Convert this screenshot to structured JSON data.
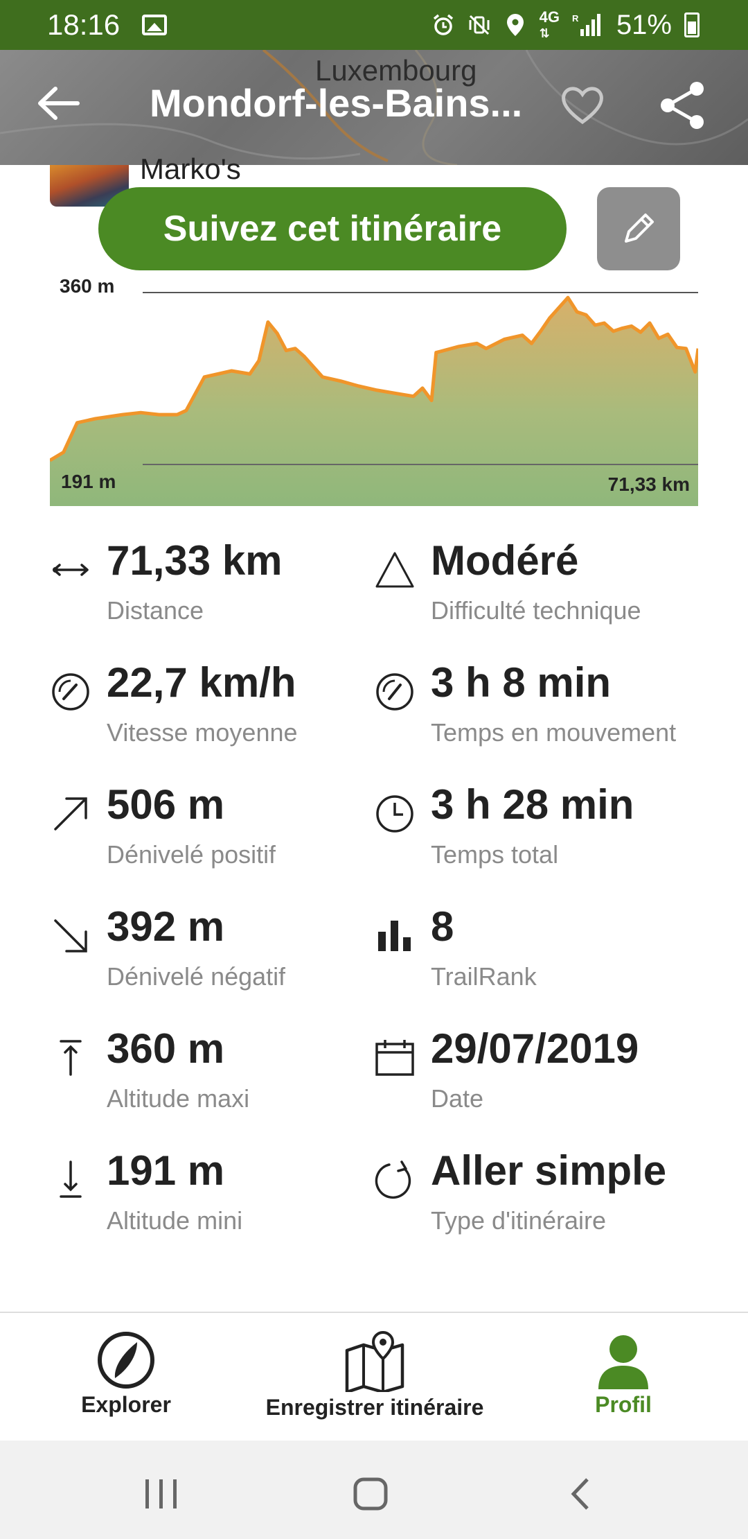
{
  "status_bar": {
    "time": "18:16",
    "network_top": "4G",
    "network_bottom": "R",
    "battery": "51%"
  },
  "header": {
    "map_label": "Luxembourg",
    "title": "Mondorf-les-Bains..."
  },
  "author": {
    "name": "Marko's"
  },
  "actions": {
    "follow_label": "Suivez cet itinéraire"
  },
  "chart_data": {
    "type": "area",
    "title": "",
    "xlabel": "",
    "ylabel": "",
    "y_max_label": "360 m",
    "y_min_label": "191 m",
    "x_end_label": "71,33 km",
    "xlim": [
      0,
      71.33
    ],
    "ylim": [
      191,
      360
    ],
    "x": [
      0,
      1.5,
      3,
      5,
      8,
      10,
      12,
      14,
      15,
      17,
      20,
      22,
      23,
      24,
      25,
      26,
      27,
      28,
      30,
      32,
      34,
      36,
      38,
      40,
      41,
      42,
      42.5,
      45,
      47,
      48,
      50,
      52,
      53,
      54,
      55,
      56,
      57,
      58,
      59,
      60,
      61,
      62,
      63,
      64,
      65,
      66,
      67,
      68,
      69,
      70,
      71,
      71.33
    ],
    "y": [
      195,
      203,
      232,
      236,
      240,
      242,
      240,
      240,
      244,
      277,
      283,
      280,
      293,
      331,
      320,
      303,
      305,
      297,
      277,
      273,
      268,
      264,
      261,
      258,
      266,
      254,
      301,
      307,
      310,
      305,
      314,
      318,
      310,
      322,
      335,
      345,
      355,
      341,
      338,
      328,
      330,
      322,
      325,
      327,
      321,
      330,
      315,
      319,
      306,
      305,
      282,
      305
    ],
    "fill_top_color": "#d8b06a",
    "fill_bottom_color": "#8fb77b",
    "line_color": "#f0952a"
  },
  "stats": [
    {
      "icon": "distance-icon",
      "value": "71,33 km",
      "label": "Distance"
    },
    {
      "icon": "difficulty-icon",
      "value": "Modéré",
      "label": "Difficulté technique"
    },
    {
      "icon": "speed-icon",
      "value": "22,7 km/h",
      "label": "Vitesse moyenne"
    },
    {
      "icon": "moving-time-icon",
      "value": "3 h 8 min",
      "label": "Temps en mouvement"
    },
    {
      "icon": "elevation-gain-icon",
      "value": "506 m",
      "label": "Dénivelé positif"
    },
    {
      "icon": "clock-icon",
      "value": "3 h 28 min",
      "label": "Temps total"
    },
    {
      "icon": "elevation-loss-icon",
      "value": "392 m",
      "label": "Dénivelé négatif"
    },
    {
      "icon": "trailrank-icon",
      "value": "8",
      "label": "TrailRank"
    },
    {
      "icon": "altitude-max-icon",
      "value": "360 m",
      "label": "Altitude maxi"
    },
    {
      "icon": "calendar-icon",
      "value": "29/07/2019",
      "label": "Date"
    },
    {
      "icon": "altitude-min-icon",
      "value": "191 m",
      "label": "Altitude mini"
    },
    {
      "icon": "route-type-icon",
      "value": "Aller simple",
      "label": "Type d'itinéraire"
    }
  ],
  "bottom_nav": {
    "explore": "Explorer",
    "record": "Enregistrer itinéraire",
    "profile": "Profil"
  },
  "colors": {
    "brand_green": "#4b8a24",
    "status_bar": "#3f6e1e",
    "active_nav": "#4b8a24"
  }
}
